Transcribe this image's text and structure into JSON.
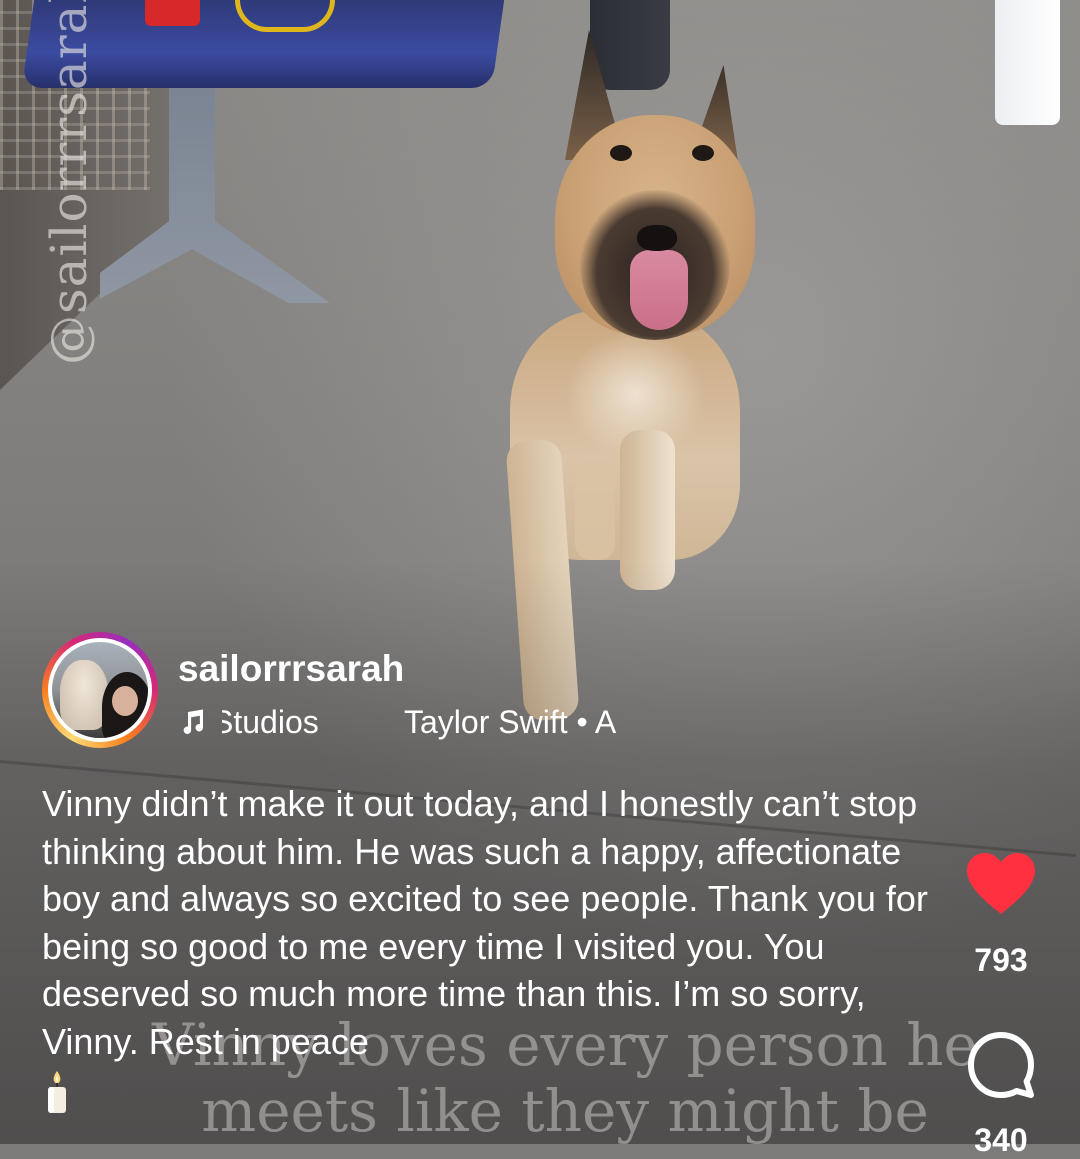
{
  "watermark": "@sailorrrsarah",
  "video_overlay_text": "Vinny loves every person he\nmeets like they might be",
  "post": {
    "username": "sailorrrsarah",
    "music": {
      "icon": "music-note-icon",
      "song": "Studios",
      "artist": "Taylor Swift • A"
    },
    "caption": "Vinny didn’t make it out today, and I honestly can’t stop thinking about him. He was such a happy, affectionate boy and always so excited to see people. Thank you for being so good to me every time I visited you. You deserved so much more time than this. I’m so sorry, Vinny. Rest in peace",
    "caption_emoji": "candle-icon"
  },
  "actions": {
    "like": {
      "icon": "heart-icon",
      "count": "793",
      "color": "#ff3040",
      "liked": true
    },
    "comment": {
      "icon": "comment-bubble-icon",
      "count": "340"
    }
  }
}
